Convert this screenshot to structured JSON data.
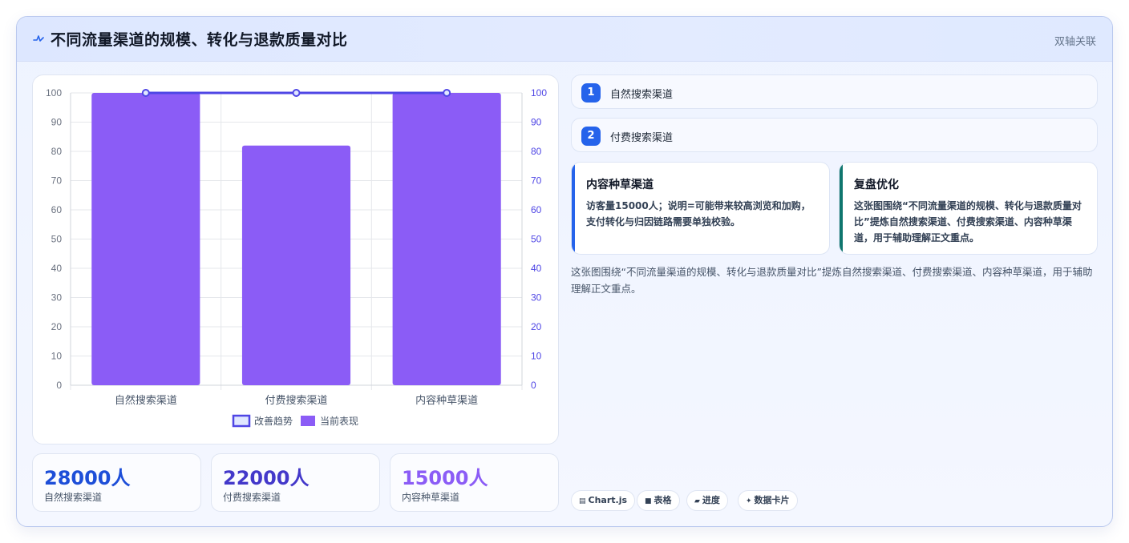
{
  "header": {
    "title": "不同流量渠道的规模、转化与退款质量对比",
    "tag": "双轴关联"
  },
  "chart_data": {
    "type": "bar",
    "categories": [
      "自然搜索渠道",
      "付费搜索渠道",
      "内容种草渠道"
    ],
    "series": [
      {
        "name": "改善趋势",
        "type": "line",
        "axis": "right",
        "values": [
          100,
          100,
          100
        ],
        "color": "#4f46e5"
      },
      {
        "name": "当前表现",
        "type": "bar",
        "axis": "left",
        "values": [
          100,
          82,
          100
        ],
        "color": "#8b5cf6"
      }
    ],
    "ylim": [
      0,
      100
    ],
    "y2lim": [
      0,
      100
    ],
    "yticks": [
      0,
      10,
      20,
      30,
      40,
      50,
      60,
      70,
      80,
      90,
      100
    ],
    "grid": true,
    "legend_position": "bottom"
  },
  "stats": [
    {
      "value": "28000人",
      "label": "自然搜索渠道",
      "color": "#1d4ed8"
    },
    {
      "value": "22000人",
      "label": "付费搜索渠道",
      "color": "#4338ca"
    },
    {
      "value": "15000人",
      "label": "内容种草渠道",
      "color": "#8b5cf6"
    }
  ],
  "list": [
    {
      "num": "1",
      "label": "自然搜索渠道"
    },
    {
      "num": "2",
      "label": "付费搜索渠道"
    }
  ],
  "cards": [
    {
      "title": "内容种草渠道",
      "body": "访客量15000人；说明=可能带来较高浏览和加购，支付转化与归因链路需要单独校验。",
      "accent": "#2563eb"
    },
    {
      "title": "复盘优化",
      "body": "这张图围绕“不同流量渠道的规模、转化与退款质量对比”提炼自然搜索渠道、付费搜索渠道、内容种草渠道，用于辅助理解正文重点。",
      "accent": "#0f766e"
    }
  ],
  "summary": "这张图围绕“不同流量渠道的规模、转化与退款质量对比”提炼自然搜索渠道、付费搜索渠道、内容种草渠道，用于辅助理解正文重点。",
  "chips": [
    {
      "icon": "chart-icon",
      "glyph": "▤",
      "label": "Chart.js"
    },
    {
      "icon": "table-icon",
      "glyph": "■",
      "label": "表格"
    },
    {
      "icon": "progress-icon",
      "glyph": "▰",
      "label": "进度"
    },
    {
      "icon": "sparkle-icon",
      "glyph": "✦",
      "label": "数据卡片"
    }
  ]
}
